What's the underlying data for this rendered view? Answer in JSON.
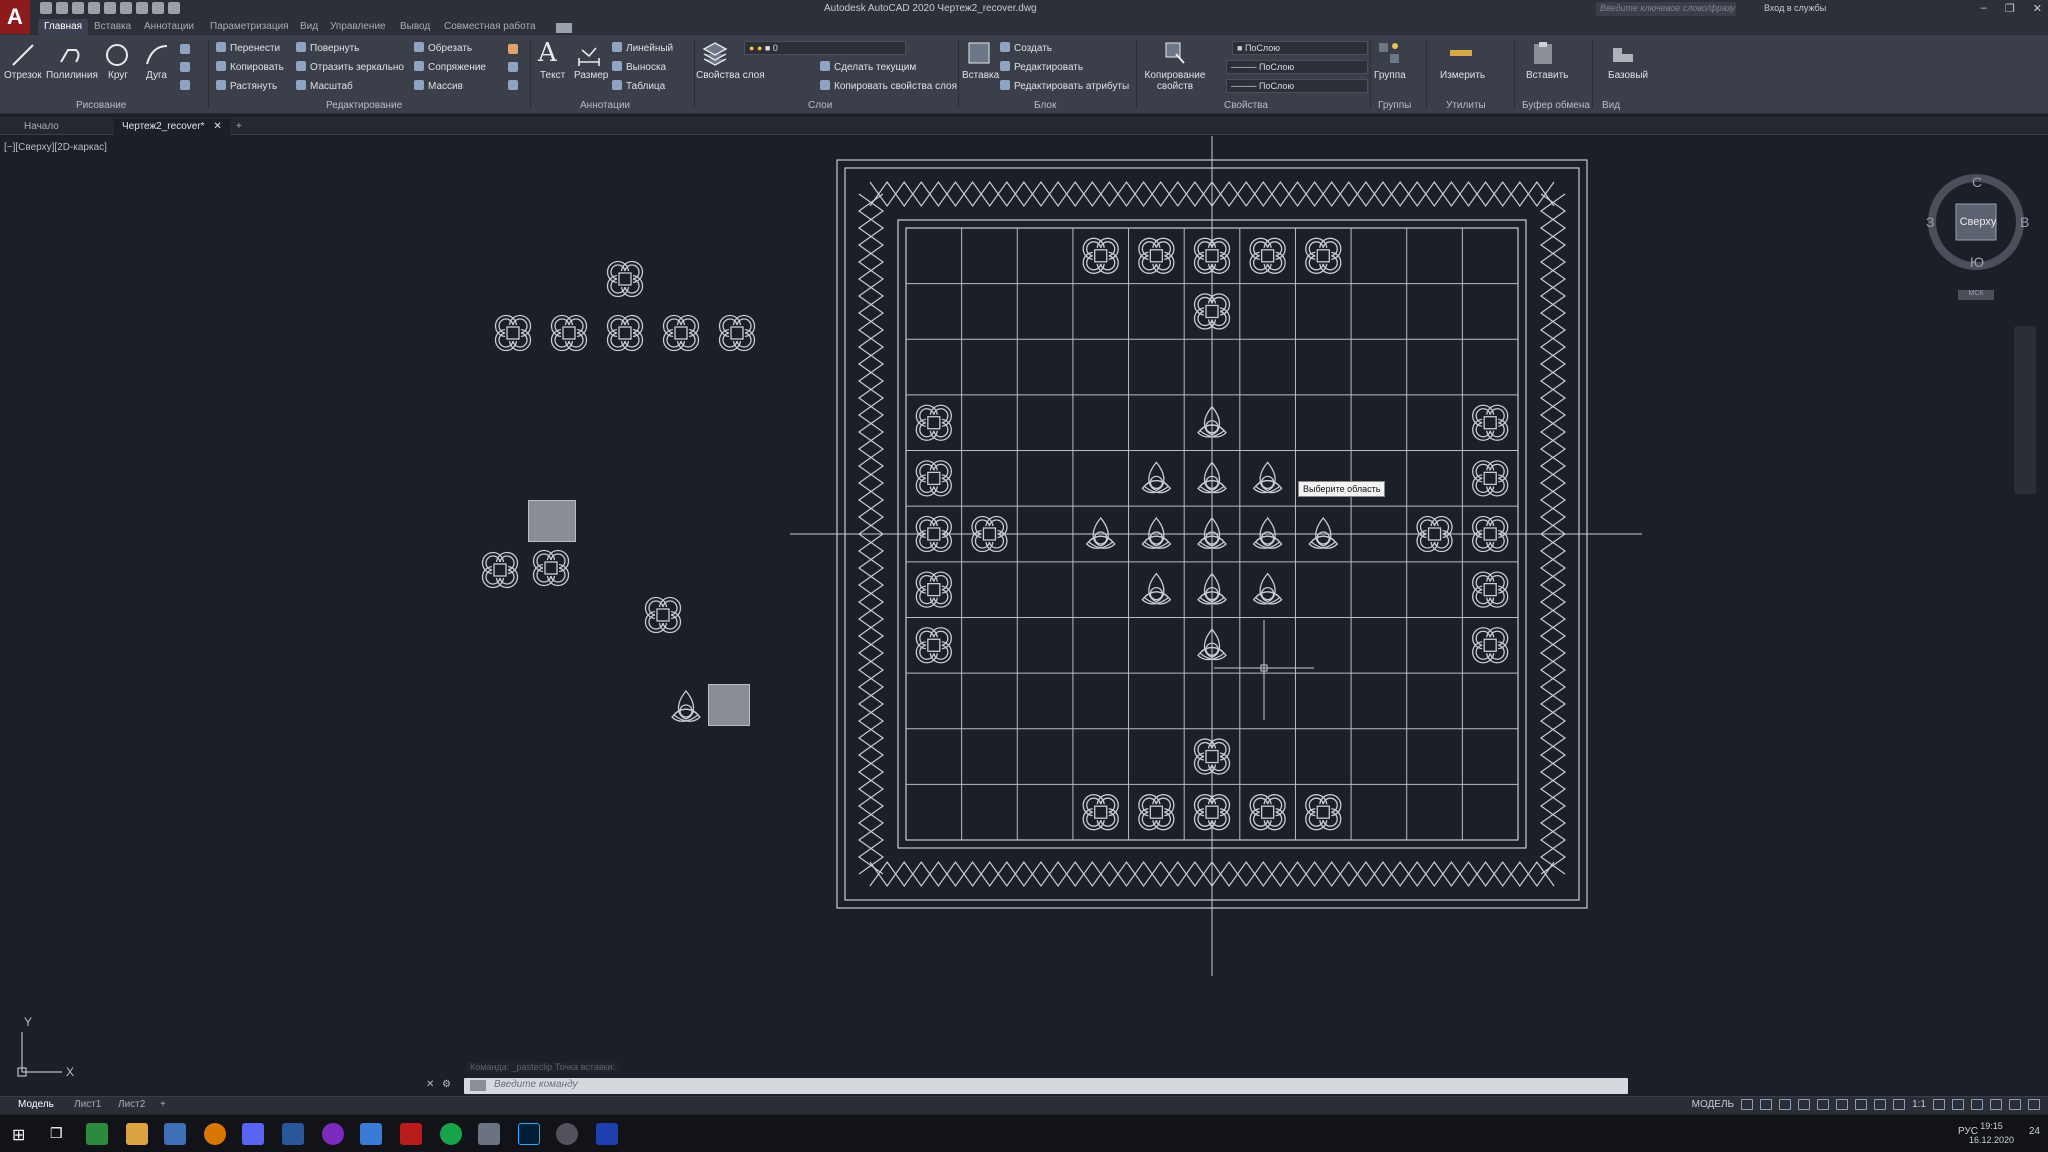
{
  "window": {
    "title": "Autodesk AutoCAD 2020   Чертеж2_recover.dwg",
    "search_placeholder": "Введите ключевое слово/фразу",
    "login": "Вход в службы"
  },
  "menu": [
    "Главная",
    "Вставка",
    "Аннотации",
    "Параметризация",
    "Вид",
    "Управление",
    "Вывод",
    "Совместная работа"
  ],
  "ribbon": {
    "draw": {
      "line": "Отрезок",
      "polyline": "Полилиния",
      "circle": "Круг",
      "arc": "Дуга",
      "panel": "Рисование"
    },
    "modify": {
      "move": "Перенести",
      "copy": "Копировать",
      "stretch": "Растянуть",
      "rotate": "Повернуть",
      "mirror": "Отразить зеркально",
      "scale": "Масштаб",
      "trim": "Обрезать",
      "fillet": "Сопряжение",
      "array": "Массив",
      "panel": "Редактирование"
    },
    "annotation": {
      "text": "Текст",
      "dimension": "Размер",
      "linear": "Линейный",
      "leader": "Выноска",
      "table": "Таблица",
      "panel": "Аннотации"
    },
    "layers": {
      "props": "Свойства слоя",
      "current_layer": "0",
      "make_current": "Сделать текущим",
      "copy_props": "Копировать свойства слоя",
      "panel": "Слои"
    },
    "block": {
      "insert": "Вставка",
      "create": "Создать",
      "edit": "Редактировать",
      "edit_attrs": "Редактировать атрибуты",
      "panel": "Блок"
    },
    "properties": {
      "match": "Копирование свойств",
      "color": "ПоСлою",
      "linetype": "ПоСлою",
      "lineweight": "ПоСлою",
      "panel": "Свойства"
    },
    "groups": {
      "group": "Группа",
      "panel": "Группы"
    },
    "utilities": {
      "measure": "Измерить",
      "panel": "Утилиты"
    },
    "clipboard": {
      "paste": "Вставить",
      "panel": "Буфер обмена"
    },
    "view": {
      "base": "Базовый",
      "panel": "Вид"
    }
  },
  "tabs": {
    "start": "Начало",
    "drawing": "Чертеж2_recover*"
  },
  "viewport": {
    "label": "[−][Сверху][2D-каркас]",
    "tooltip": "Выберите область",
    "axis_x": "X",
    "axis_y": "Y"
  },
  "viewcube": {
    "n": "С",
    "s": "Ю",
    "e": "В",
    "w": "З",
    "face": "Сверху",
    "ucs": "МСК"
  },
  "command": {
    "history": "Команда: _pasteclip Точка вставки:",
    "placeholder": "Введите команду"
  },
  "layouts": [
    "Модель",
    "Лист1",
    "Лист2"
  ],
  "status": {
    "model": "МОДЕЛЬ",
    "scale": "1:1"
  },
  "taskbar": {
    "lang": "РУС",
    "time": "19:15",
    "date": "16.12.2020",
    "notif": "24"
  },
  "colors": {
    "bg": "#1b1f27",
    "ribbon": "#3b3f49",
    "titlebar": "#2d3039",
    "brand": "#8e1b1b",
    "line": "#c9ccd1"
  }
}
